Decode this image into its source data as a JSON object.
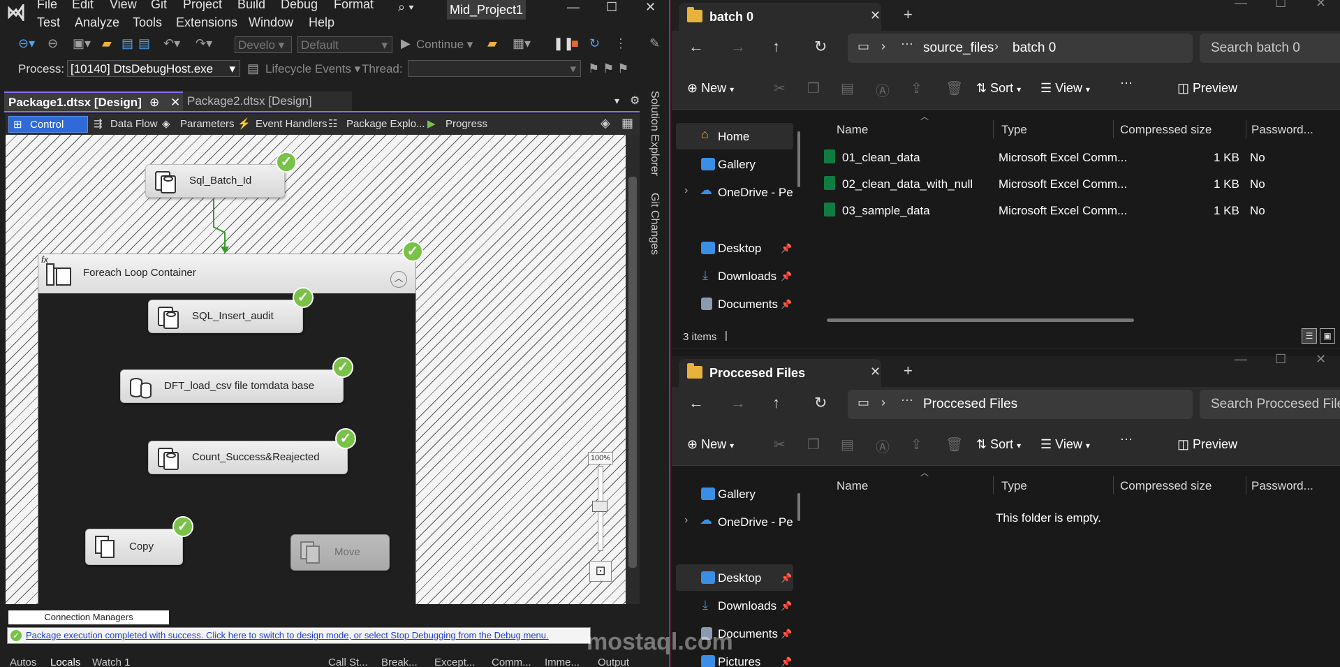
{
  "vs": {
    "menu": [
      "File",
      "Edit",
      "View",
      "Git",
      "Project",
      "Build",
      "Debug",
      "Format",
      "Test",
      "Analyze",
      "Tools",
      "Extensions",
      "Window",
      "Help"
    ],
    "project_title": "Mid_Project1",
    "toolbar": {
      "develop_combo": "Develo",
      "default_combo": "Default",
      "continue_label": "Continue",
      "process_label": "Process:",
      "process_value": "[10140] DtsDebugHost.exe",
      "lifecycle_label": "Lifecycle Events",
      "thread_label": "Thread:"
    },
    "doc_tabs": [
      "Package1.dtsx [Design]",
      "Package2.dtsx [Design]"
    ],
    "design_tabs": [
      "Control Flow",
      "Data Flow",
      "Parameters",
      "Event Handlers",
      "Package Explo...",
      "Progress"
    ],
    "side_tabs": [
      "Solution Explorer",
      "Git Changes"
    ],
    "tasks": {
      "sql_batch_id": "Sql_Batch_Id",
      "foreach": "Foreach Loop Container",
      "sql_insert_audit": "SQL_Insert_audit",
      "dft_load": "DFT_load_csv file tomdata base",
      "count": "Count_Success&Reajected",
      "copy": "Copy",
      "move": "Move"
    },
    "zoom": "100%",
    "connection_managers": "Connection Managers",
    "status_message": "Package execution completed with success. Click here to switch to design mode, or select Stop Debugging from the Debug menu.",
    "bottom_tabs": [
      "Autos",
      "Locals",
      "Watch 1",
      "Call St...",
      "Break...",
      "Except...",
      "Comm...",
      "Imme...",
      "Output"
    ]
  },
  "explorer1": {
    "tab_title": "batch 0",
    "breadcrumb": [
      "source_files",
      "batch 0"
    ],
    "search_placeholder": "Search batch 0",
    "commands": {
      "new": "New",
      "sort": "Sort",
      "view": "View",
      "preview": "Preview"
    },
    "nav": [
      "Home",
      "Gallery",
      "OneDrive - Pe",
      "Desktop",
      "Downloads",
      "Documents"
    ],
    "columns": [
      "Name",
      "Type",
      "Compressed size",
      "Password..."
    ],
    "rows": [
      {
        "name": "01_clean_data",
        "type": "Microsoft Excel Comm...",
        "size": "1 KB",
        "password": "No"
      },
      {
        "name": "02_clean_data_with_null",
        "type": "Microsoft Excel Comm...",
        "size": "1 KB",
        "password": "No"
      },
      {
        "name": "03_sample_data",
        "type": "Microsoft Excel Comm...",
        "size": "1 KB",
        "password": "No"
      }
    ],
    "status": "3 items"
  },
  "explorer2": {
    "tab_title": "Proccesed Files",
    "breadcrumb": [
      "Proccesed Files"
    ],
    "search_placeholder": "Search Proccesed Files",
    "commands": {
      "new": "New",
      "sort": "Sort",
      "view": "View",
      "preview": "Preview"
    },
    "nav": [
      "Gallery",
      "OneDrive - Pe",
      "Desktop",
      "Downloads",
      "Documents",
      "Pictures"
    ],
    "columns": [
      "Name",
      "Type",
      "Compressed size",
      "Password..."
    ],
    "empty_message": "This folder is empty."
  },
  "watermark": "mostaql.com",
  "colors": {
    "check": "#78c247",
    "accent": "#c2186b",
    "link": "#1a3ed8",
    "excel": "#107c41"
  }
}
